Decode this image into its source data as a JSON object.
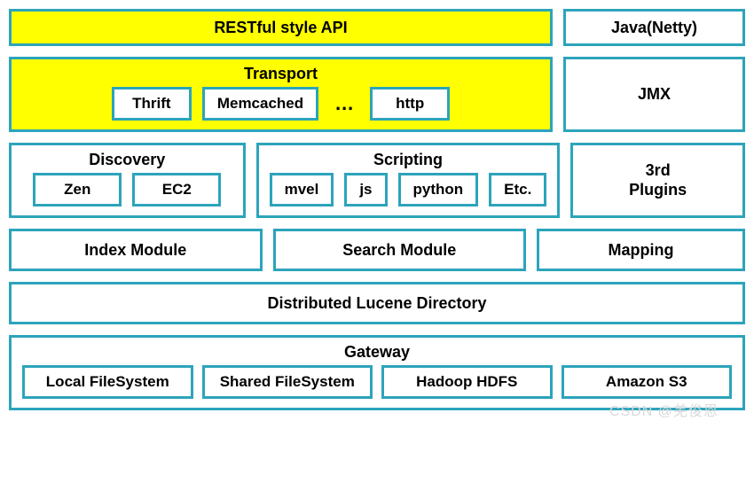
{
  "row1": {
    "api": "RESTful style API",
    "java": "Java(Netty)"
  },
  "transport": {
    "title": "Transport",
    "items": [
      "Thrift",
      "Memcached",
      "http"
    ],
    "dots": "…"
  },
  "jmx": "JMX",
  "discovery": {
    "title": "Discovery",
    "items": [
      "Zen",
      "EC2"
    ]
  },
  "scripting": {
    "title": "Scripting",
    "items": [
      "mvel",
      "js",
      "python",
      "Etc."
    ]
  },
  "plugins": {
    "line1": "3rd",
    "line2": "Plugins"
  },
  "modules": {
    "index": "Index Module",
    "search": "Search Module",
    "mapping": "Mapping"
  },
  "lucene": "Distributed Lucene Directory",
  "gateway": {
    "title": "Gateway",
    "items": [
      "Local FileSystem",
      "Shared FileSystem",
      "Hadoop HDFS",
      "Amazon S3"
    ]
  },
  "watermark": "CSDN @羌俊恩"
}
